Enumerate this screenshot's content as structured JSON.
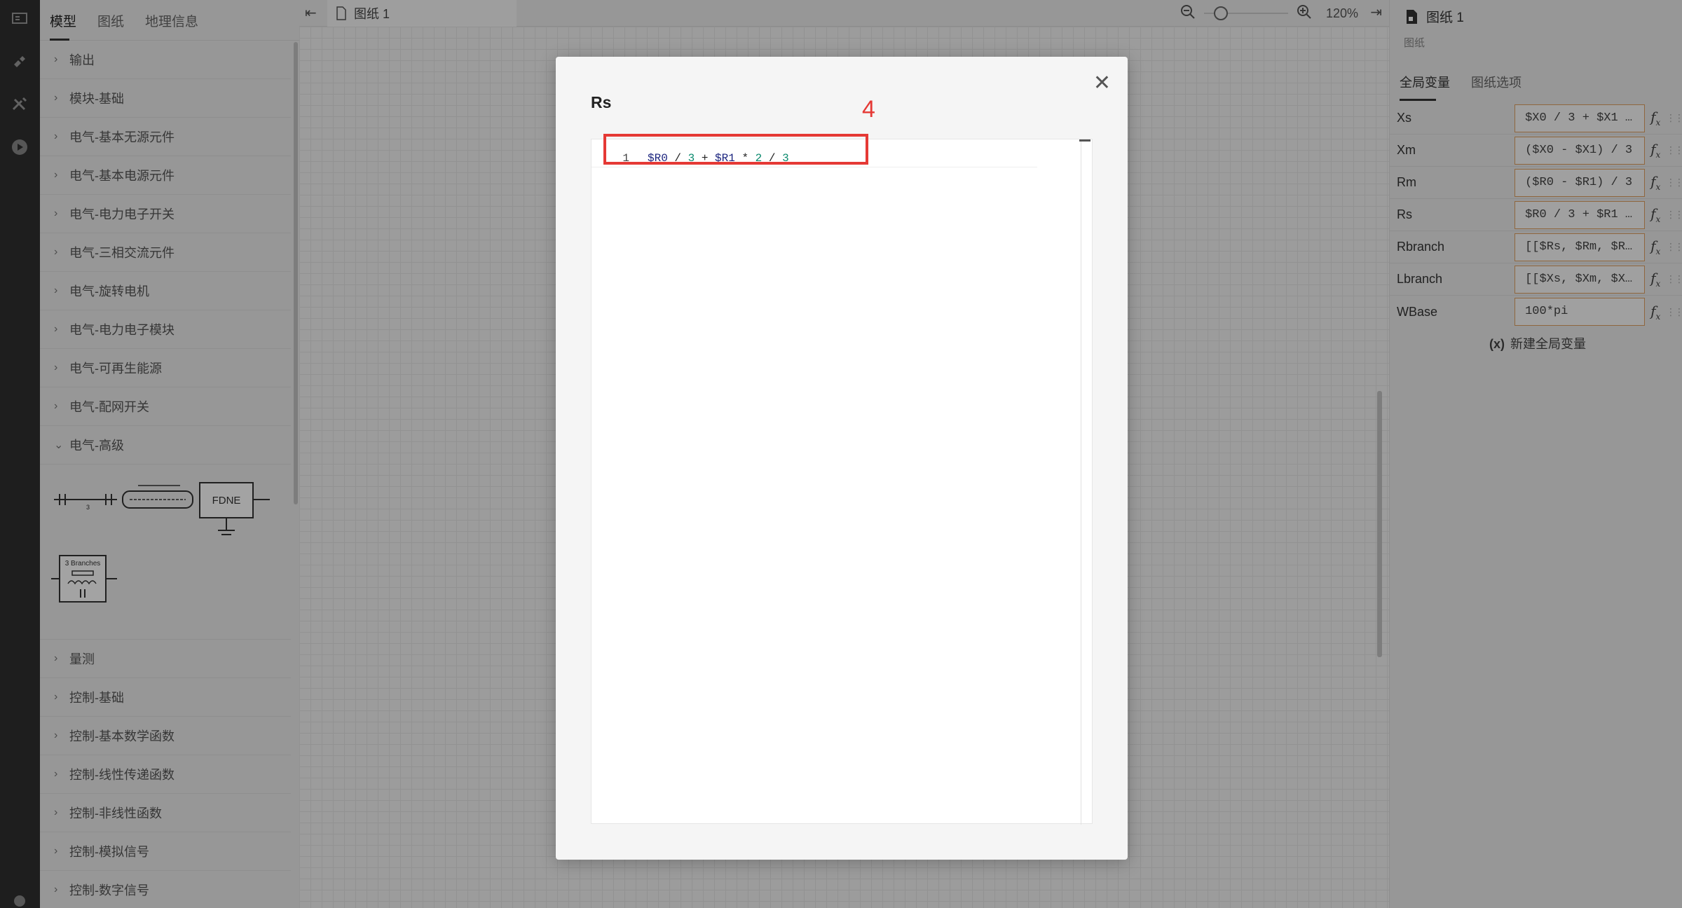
{
  "library": {
    "tabs": [
      "模型",
      "图纸",
      "地理信息"
    ],
    "categories_top": [
      "输出",
      "模块-基础",
      "电气-基本无源元件",
      "电气-基本电源元件",
      "电气-电力电子开关",
      "电气-三相交流元件",
      "电气-旋转电机",
      "电气-电力电子模块",
      "电气-可再生能源",
      "电气-配网开关",
      "电气-高级"
    ],
    "symbols": {
      "fdne_label": "FDNE",
      "branches_label": "3 Branches",
      "tline_label": "3"
    },
    "categories_bottom": [
      "量测",
      "控制-基础",
      "控制-基本数学函数",
      "控制-线性传递函数",
      "控制-非线性函数",
      "控制-模拟信号",
      "控制-数字信号"
    ]
  },
  "toolbar": {
    "doc_tab": "图纸 1",
    "zoom": "120%"
  },
  "props": {
    "title": "图纸 1",
    "subtitle": "图纸",
    "tabs": [
      "全局变量",
      "图纸选项"
    ],
    "variables": [
      {
        "name": "Xs",
        "value": "$X0 / 3 + $X1 *…"
      },
      {
        "name": "Xm",
        "value": "($X0 - $X1) / 3"
      },
      {
        "name": "Rm",
        "value": "($R0 - $R1) / 3"
      },
      {
        "name": "Rs",
        "value": "$R0 / 3 + $R1 *…"
      },
      {
        "name": "Rbranch",
        "value": "[[$Rs, $Rm, $Rm…"
      },
      {
        "name": "Lbranch",
        "value": "[[$Xs, $Xm, $Xm…"
      },
      {
        "name": "WBase",
        "value": "100*pi"
      }
    ],
    "new_var_prefix": "(x)",
    "new_var_label": "新建全局变量"
  },
  "modal": {
    "title": "Rs",
    "close_glyph": "✕",
    "line_number": "1",
    "code_tokens": [
      {
        "t": "$R0",
        "c": "var"
      },
      {
        "t": " / ",
        "c": "op"
      },
      {
        "t": "3",
        "c": "num"
      },
      {
        "t": " + ",
        "c": "op"
      },
      {
        "t": "$R1",
        "c": "var"
      },
      {
        "t": " * ",
        "c": "op"
      },
      {
        "t": "2",
        "c": "num"
      },
      {
        "t": " / ",
        "c": "op"
      },
      {
        "t": "3",
        "c": "num"
      }
    ],
    "annotation_number": "4"
  },
  "colors": {
    "highlight": "#e53935",
    "accent_border": "#e0a060"
  },
  "icons": [
    "panel-icon",
    "plugin-icon",
    "tools-icon",
    "play-icon",
    "settings-icon",
    "collapse-left-icon",
    "document-icon",
    "zoom-out-icon",
    "zoom-in-icon",
    "expand-right-icon",
    "sheet-icon",
    "close-icon",
    "fx-icon",
    "drag-handle-icon",
    "chevron-right-icon",
    "chevron-down-icon"
  ]
}
